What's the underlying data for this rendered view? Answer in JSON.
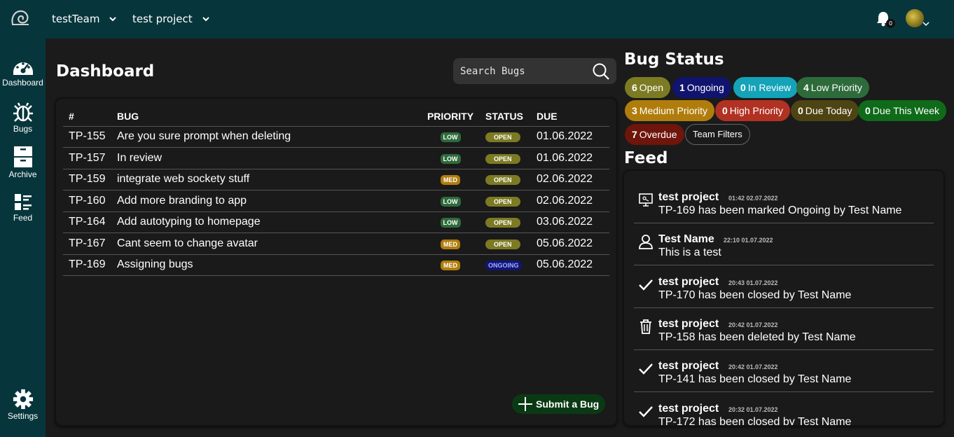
{
  "header": {
    "team": "testTeam",
    "project": "test project",
    "notification_count": "0"
  },
  "sidebar": {
    "items": [
      {
        "label": "Dashboard",
        "icon": "dashboard-icon"
      },
      {
        "label": "Bugs",
        "icon": "bug-icon"
      },
      {
        "label": "Archive",
        "icon": "archive-icon"
      },
      {
        "label": "Feed",
        "icon": "feed-icon"
      },
      {
        "label": "Settings",
        "icon": "gear-icon"
      }
    ]
  },
  "dashboard": {
    "title": "Dashboard",
    "search_placeholder": "Search Bugs",
    "columns": [
      "#",
      "BUG",
      "PRIORITY",
      "STATUS",
      "DUE"
    ],
    "rows": [
      {
        "id": "TP-155",
        "bug": "Are you sure prompt when deleting",
        "priority": "LOW",
        "status": "OPEN",
        "due": "01.06.2022"
      },
      {
        "id": "TP-157",
        "bug": "In review",
        "priority": "LOW",
        "status": "OPEN",
        "due": "01.06.2022"
      },
      {
        "id": "TP-159",
        "bug": "integrate web sockety stuff",
        "priority": "MED",
        "status": "OPEN",
        "due": "02.06.2022"
      },
      {
        "id": "TP-160",
        "bug": "Add more branding to app",
        "priority": "LOW",
        "status": "OPEN",
        "due": "02.06.2022"
      },
      {
        "id": "TP-164",
        "bug": "Add autotyping to homepage",
        "priority": "LOW",
        "status": "OPEN",
        "due": "03.06.2022"
      },
      {
        "id": "TP-167",
        "bug": "Cant seem to change avatar",
        "priority": "MED",
        "status": "OPEN",
        "due": "05.06.2022"
      },
      {
        "id": "TP-169",
        "bug": "Assigning bugs",
        "priority": "MED",
        "status": "ONGOING",
        "due": "05.06.2022"
      }
    ],
    "submit_label": "Submit a Bug"
  },
  "bug_status": {
    "title": "Bug Status",
    "badges": [
      {
        "count": "6",
        "label": "Open",
        "color": "#7c7b24"
      },
      {
        "count": "1",
        "label": "Ongoing",
        "color": "#10146e"
      },
      {
        "count": "0",
        "label": "In Review",
        "color": "#14a3b8"
      },
      {
        "count": "4",
        "label": "Low Priority",
        "color": "#2e6b3b"
      },
      {
        "count": "3",
        "label": "Medium Priority",
        "color": "#b07d0c"
      },
      {
        "count": "0",
        "label": "High Priority",
        "color": "#b13123"
      },
      {
        "count": "0",
        "label": "Due Today",
        "color": "#4e4413"
      },
      {
        "count": "0",
        "label": "Due This Week",
        "color": "#0f6b1a"
      },
      {
        "count": "7",
        "label": "Overdue",
        "color": "#6e150c"
      }
    ],
    "team_filters_label": "Team Filters"
  },
  "feed": {
    "title": "Feed",
    "items": [
      {
        "name": "test project",
        "time": "01:42 02.07.2022",
        "message": "TP-169 has been marked Ongoing by Test Name",
        "icon": "monitor-icon"
      },
      {
        "name": "Test Name",
        "time": "22:10 01.07.2022",
        "message": "This is a test",
        "icon": "user-icon"
      },
      {
        "name": "test project",
        "time": "20:43 01.07.2022",
        "message": "TP-170 has been closed by Test Name",
        "icon": "check-icon"
      },
      {
        "name": "test project",
        "time": "20:42 01.07.2022",
        "message": "TP-158 has been deleted by Test Name",
        "icon": "trash-icon"
      },
      {
        "name": "test project",
        "time": "20:42 01.07.2022",
        "message": "TP-141 has been closed by Test Name",
        "icon": "check-icon"
      },
      {
        "name": "test project",
        "time": "20:32 01.07.2022",
        "message": "TP-172 has been closed by Test Name",
        "icon": "check-icon"
      }
    ]
  }
}
